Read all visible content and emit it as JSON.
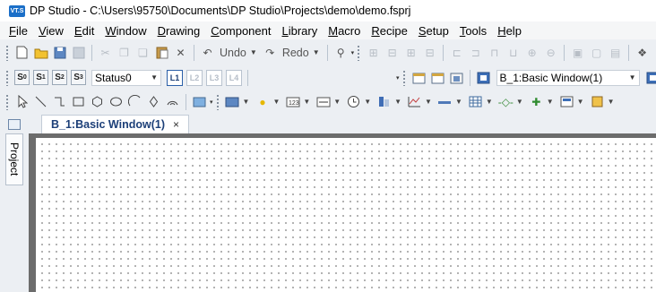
{
  "window": {
    "title": "DP Studio - C:\\Users\\95750\\Documents\\DP Studio\\Projects\\demo\\demo.fsprj",
    "app_icon_text": "VT.S"
  },
  "menu": [
    {
      "u": "F",
      "rest": "ile"
    },
    {
      "u": "V",
      "rest": "iew"
    },
    {
      "u": "E",
      "rest": "dit"
    },
    {
      "u": "W",
      "rest": "indow"
    },
    {
      "u": "D",
      "rest": "rawing"
    },
    {
      "u": "C",
      "rest": "omponent"
    },
    {
      "u": "L",
      "rest": "ibrary"
    },
    {
      "u": "M",
      "rest": "acro"
    },
    {
      "u": "R",
      "rest": "ecipe"
    },
    {
      "u": "S",
      "rest": "etup"
    },
    {
      "u": "T",
      "rest": "ools"
    },
    {
      "u": "H",
      "rest": "elp"
    }
  ],
  "toolbar1": {
    "undo_label": "Undo",
    "redo_label": "Redo"
  },
  "toolbar2": {
    "status_buttons": [
      {
        "main": "S",
        "sub": "0"
      },
      {
        "main": "S",
        "sub": "1"
      },
      {
        "main": "S",
        "sub": "2"
      },
      {
        "main": "S",
        "sub": "3"
      }
    ],
    "status_select": "Status0",
    "layer_buttons": [
      "L1",
      "L2",
      "L3",
      "L4"
    ],
    "window_select": "B_1:Basic Window(1)"
  },
  "sidebar": {
    "project_tab": "Project"
  },
  "document": {
    "tab_label": "B_1:Basic Window(1)",
    "close_glyph": "×"
  },
  "colors": {
    "toolbar_bg": "#eceff3",
    "tab_text": "#1c3f78",
    "canvas_frame": "#6c6c6c",
    "grid_dot": "#9a9a9a"
  }
}
